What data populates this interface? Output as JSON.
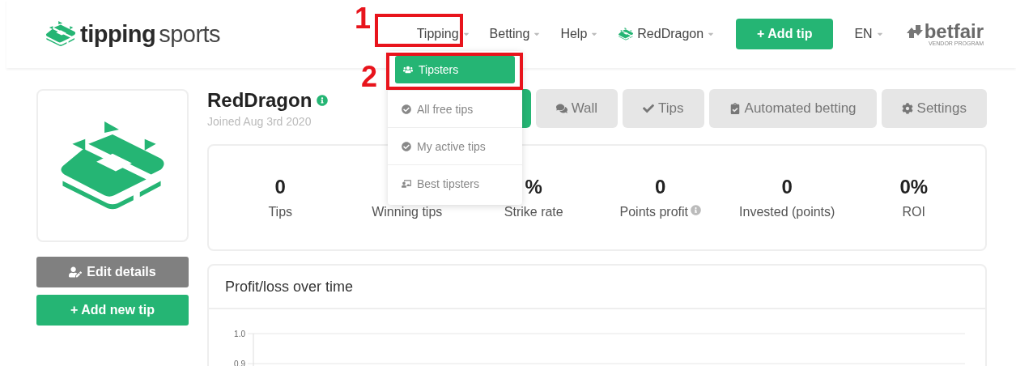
{
  "header": {
    "logo": {
      "bold": "tipping",
      "light": "sports"
    },
    "nav": [
      {
        "label": "Tipping",
        "kind": "menu"
      },
      {
        "label": "Betting",
        "kind": "menu"
      },
      {
        "label": "Help",
        "kind": "menu"
      },
      {
        "label": "RedDragon",
        "kind": "account"
      },
      {
        "label": "+ Add tip",
        "kind": "button"
      },
      {
        "label": "EN",
        "kind": "menu"
      }
    ],
    "partner": {
      "name": "betfair",
      "tagline": "VENDOR PROGRAM"
    }
  },
  "dropdown": [
    {
      "label": "Tipsters",
      "selected": true
    },
    {
      "label": "All free tips",
      "selected": false
    },
    {
      "label": "My active tips",
      "selected": false
    },
    {
      "label": "Best tipsters",
      "selected": false
    }
  ],
  "annotations": [
    {
      "number": "1"
    },
    {
      "number": "2"
    }
  ],
  "sidebar": {
    "buttons": [
      {
        "label": "Edit details",
        "kind": "edit"
      },
      {
        "label": "+ Add new tip",
        "kind": "add"
      }
    ]
  },
  "profile": {
    "name": "RedDragon",
    "joined": "Joined Aug 3rd 2020"
  },
  "tabs": [
    {
      "selected": true
    },
    {
      "label": "Wall",
      "selected": false
    },
    {
      "label": "Tips",
      "selected": false
    },
    {
      "label": "Automated betting",
      "selected": false
    },
    {
      "label": "Settings",
      "selected": false
    }
  ],
  "stats": [
    {
      "value": "0",
      "label": "Tips",
      "info": false
    },
    {
      "label": "Winning tips",
      "info": false
    },
    {
      "value": "%",
      "label": "Strike rate",
      "info": false
    },
    {
      "value": "0",
      "label": "Points profit",
      "info": true
    },
    {
      "value": "0",
      "label": "Invested (points)",
      "info": false
    },
    {
      "value": "0%",
      "label": "ROI",
      "info": false
    }
  ],
  "chart": {
    "title": "Profit/loss over time",
    "axis_labels": [
      "1.0",
      "0.9"
    ]
  }
}
